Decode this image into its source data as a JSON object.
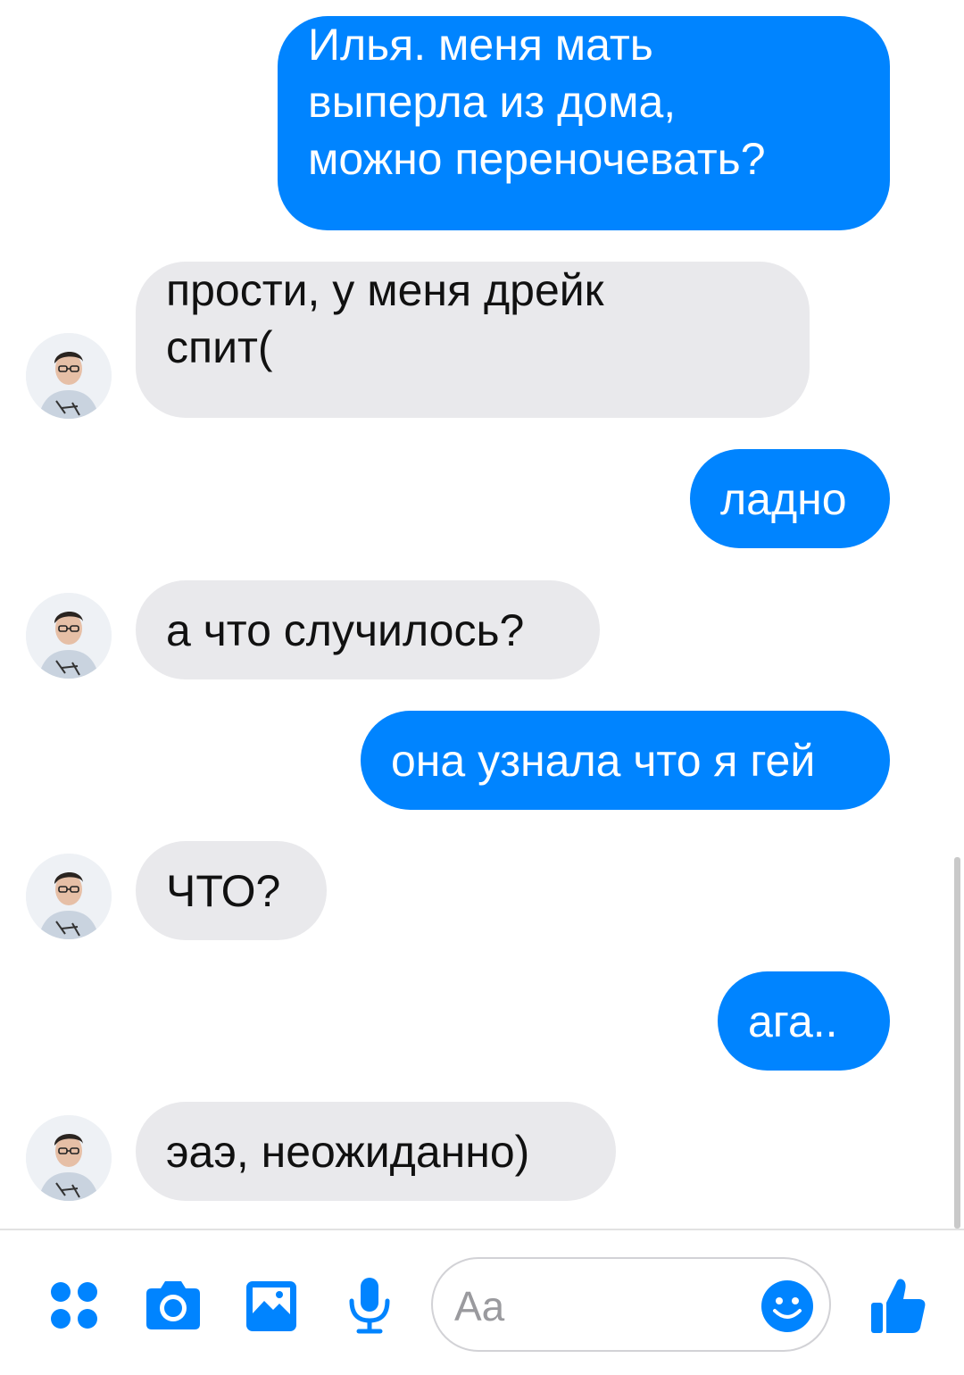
{
  "conversation": {
    "messages": [
      {
        "direction": "outgoing",
        "lines": [
          "Илья. меня мать",
          "выперла из дома,",
          "можно переночевать?"
        ]
      },
      {
        "direction": "incoming",
        "lines": [
          "прости, у меня дрейк",
          "спит("
        ]
      },
      {
        "direction": "outgoing",
        "text": "ладно"
      },
      {
        "direction": "incoming",
        "text": "а что случилось?"
      },
      {
        "direction": "outgoing",
        "text": "она узнала что я гей"
      },
      {
        "direction": "incoming",
        "text": "ЧТО?"
      },
      {
        "direction": "outgoing",
        "text": "ага.."
      },
      {
        "direction": "incoming",
        "text": "эаэ, неожиданно)"
      }
    ]
  },
  "composer": {
    "placeholder": "Aa",
    "tools": [
      "more-apps-icon",
      "camera-icon",
      "gallery-icon",
      "microphone-icon"
    ],
    "emoji_icon": "smiley-icon",
    "send_icon": "thumbs-up-icon"
  },
  "colors": {
    "accent": "#0084ff",
    "incoming_bubble": "#e9e9ec",
    "outgoing_text": "#ffffff",
    "incoming_text": "#111111"
  }
}
